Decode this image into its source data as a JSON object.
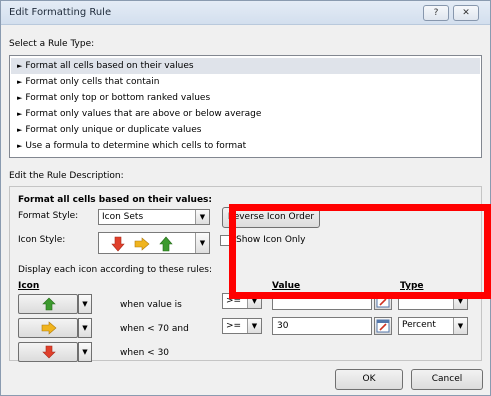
{
  "window": {
    "title": "Edit Formatting Rule",
    "help_label": "?",
    "close_label": "✕"
  },
  "rule_type": {
    "label": "Select a Rule Type:",
    "items": [
      "Format all cells based on their values",
      "Format only cells that contain",
      "Format only top or bottom ranked values",
      "Format only values that are above or below average",
      "Format only unique or duplicate values",
      "Use a formula to determine which cells to format"
    ],
    "selected_index": 0
  },
  "description": {
    "label": "Edit the Rule Description:",
    "heading": "Format all cells based on their values:",
    "format_style_label": "Format Style:",
    "format_style_value": "Icon Sets",
    "reverse_button": "Reverse Icon Order",
    "icon_style_label": "Icon Style:",
    "show_icon_only_label": "Show Icon Only",
    "show_icon_only_checked": false,
    "rules_label": "Display each icon according to these rules:",
    "col_icon": "Icon",
    "col_value": "Value",
    "col_type": "Type",
    "rows": [
      {
        "icon": "green-up-arrow-icon",
        "text": "when value is",
        "op": ">=",
        "value": "",
        "type": ""
      },
      {
        "icon": "yellow-right-arrow-icon",
        "text": "when < 70 and",
        "op": ">=",
        "value": "30",
        "type": "Percent"
      },
      {
        "icon": "red-down-arrow-icon",
        "text": "when < 30",
        "op": "",
        "value": "",
        "type": ""
      }
    ]
  },
  "footer": {
    "ok_label": "OK",
    "cancel_label": "Cancel"
  },
  "colors": {
    "up": "#3c9a2e",
    "side": "#f0b41e",
    "down": "#e0402c",
    "highlight": "#ff0000"
  }
}
